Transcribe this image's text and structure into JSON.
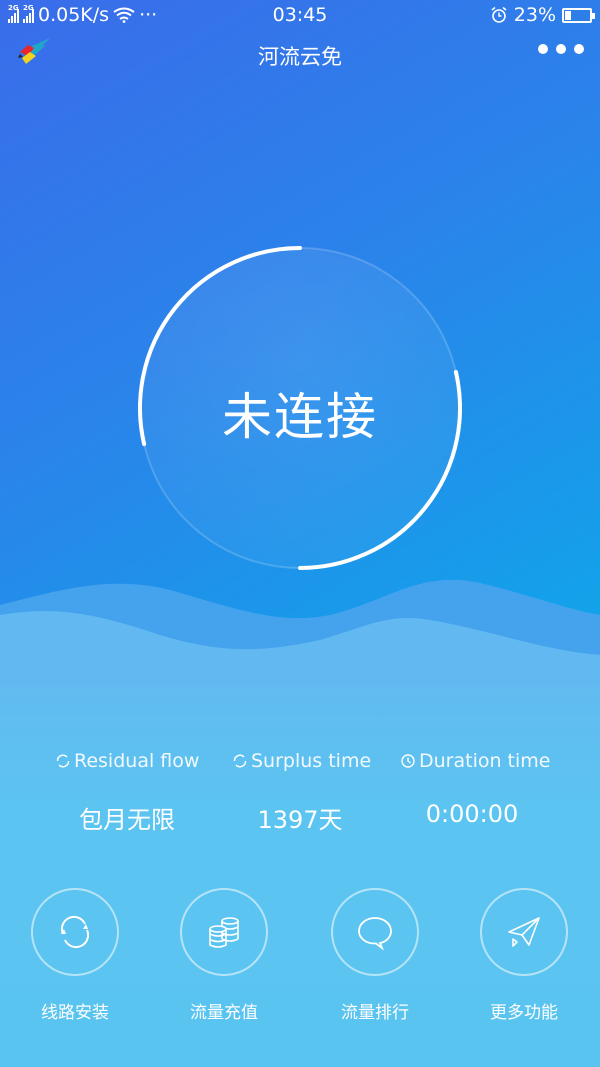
{
  "status_bar": {
    "network_1": "2G",
    "network_2": "2G",
    "speed": "0.05K/s",
    "overflow": "···",
    "time": "03:45",
    "battery_percent": "23%",
    "battery_level": 0.23
  },
  "app": {
    "title": "河流云免",
    "logo_icon": "winged-bird-logo",
    "menu_icon": "more-dots-icon"
  },
  "connection": {
    "status": "未连接",
    "progress": 0.5
  },
  "stats": [
    {
      "icon": "refresh-icon",
      "label": "Residual flow",
      "value": "包月无限"
    },
    {
      "icon": "refresh-icon",
      "label": "Surplus time",
      "value": "1397天"
    },
    {
      "icon": "clock-icon",
      "label": "Duration time",
      "value": "0:00:00"
    }
  ],
  "actions": [
    {
      "icon": "sync-icon",
      "label": "线路安装"
    },
    {
      "icon": "coins-icon",
      "label": "流量充值"
    },
    {
      "icon": "chat-bubble-icon",
      "label": "流量排行"
    },
    {
      "icon": "paper-plane-icon",
      "label": "更多功能"
    }
  ],
  "colors": {
    "top_gradient_start": "#3a6cea",
    "top_gradient_end": "#0ea8ea",
    "bottom": "#5ac4f0"
  }
}
